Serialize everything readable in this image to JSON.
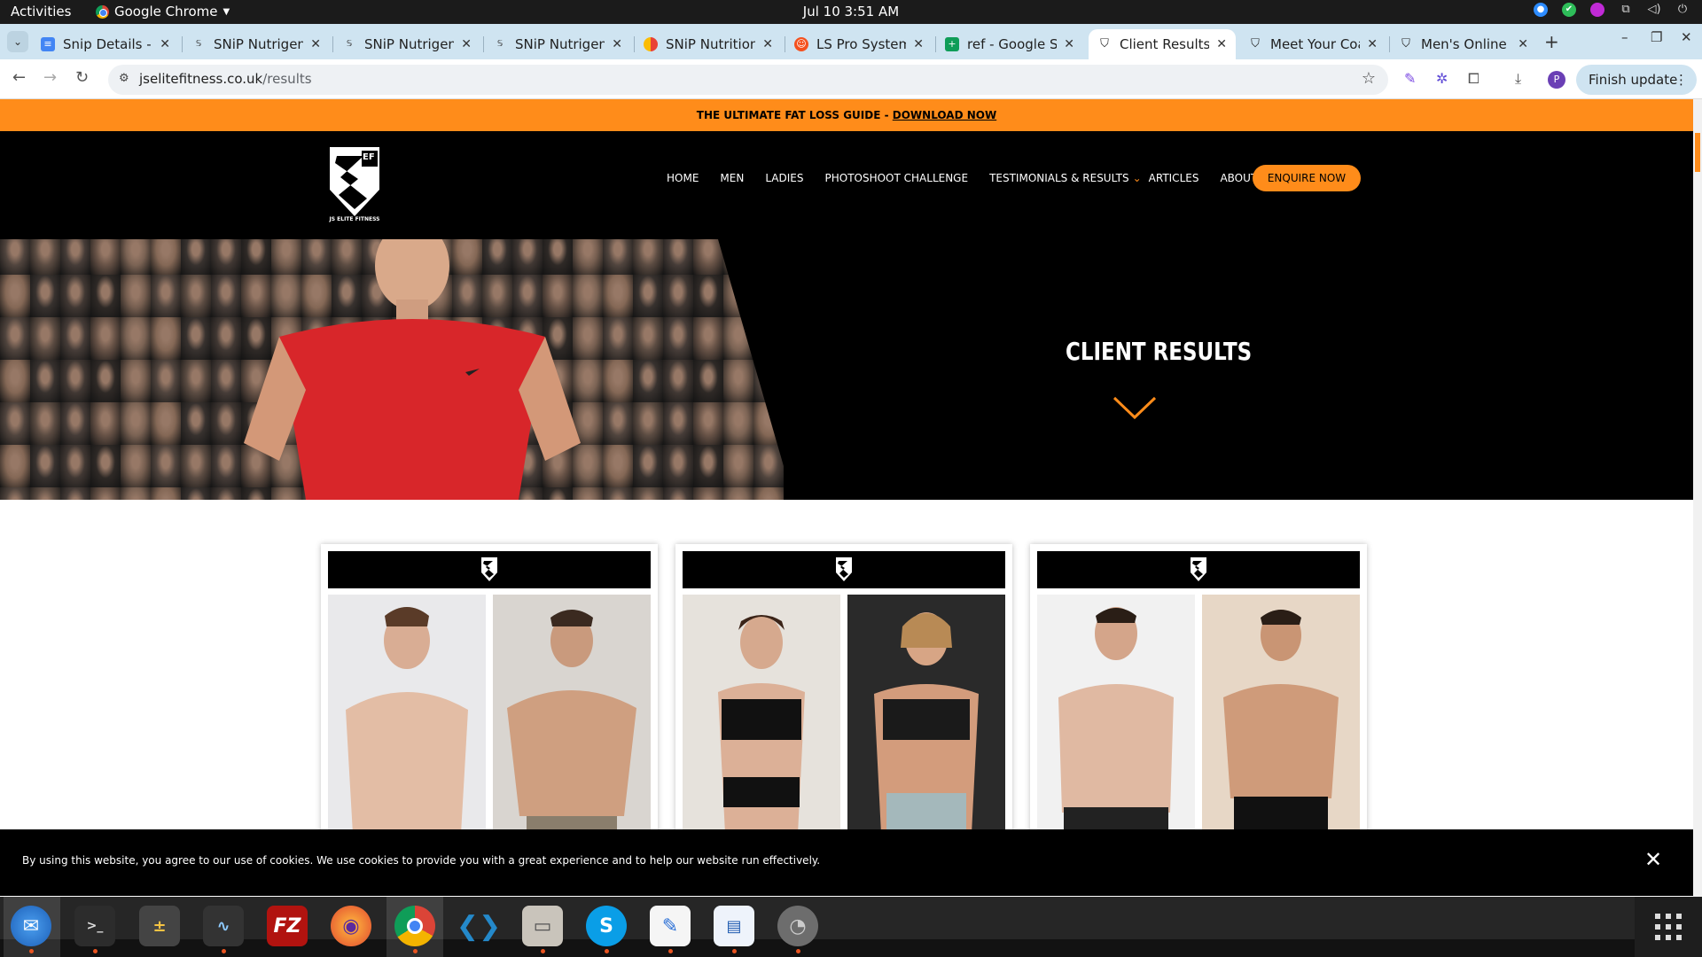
{
  "system_bar": {
    "activities": "Activities",
    "app_name": "Google Chrome",
    "clock": "Jul 10  3:51 AM",
    "tray_icons": [
      "zoom-icon",
      "checkmark-shield-icon",
      "color-ball-icon",
      "network-icon",
      "volume-icon",
      "power-icon"
    ]
  },
  "browser": {
    "tabs": [
      {
        "title": "Snip Details - C",
        "icon": "docs-icon",
        "active": false
      },
      {
        "title": "SNiP Nutrigen",
        "icon": "snip-icon",
        "active": false
      },
      {
        "title": "SNiP Nutrigen",
        "icon": "snip-icon",
        "active": false
      },
      {
        "title": "SNiP Nutrigen",
        "icon": "snip-icon",
        "active": false
      },
      {
        "title": "SNiP Nutrition",
        "icon": "snip-ball-icon",
        "active": false
      },
      {
        "title": "LS Pro System",
        "icon": "ls-icon",
        "active": false
      },
      {
        "title": "ref - Google Sh",
        "icon": "sheets-icon",
        "active": false
      },
      {
        "title": "Client Results",
        "icon": "jsef-shield-icon",
        "active": true
      },
      {
        "title": "Meet Your Coa",
        "icon": "jsef-shield-icon",
        "active": false
      },
      {
        "title": "Men's Online C",
        "icon": "jsef-shield-icon",
        "active": false
      }
    ],
    "url_host": "jselitefitness.co.uk",
    "url_path": "/results",
    "finish_update": "Finish update",
    "profile_initial": "P"
  },
  "site": {
    "promo_text": "THE ULTIMATE FAT LOSS GUIDE - ",
    "promo_link": "DOWNLOAD NOW",
    "logo_text": "JS ELITE FITNESS",
    "logo_letters": "EF",
    "menu": [
      "HOME",
      "MEN",
      "LADIES",
      "PHOTOSHOOT CHALLENGE",
      "TESTIMONIALS & RESULTS",
      "ARTICLES",
      "ABOUT"
    ],
    "enquire": "ENQUIRE NOW",
    "hero_title": "CLIENT RESULTS",
    "accent": "#ff8c1a",
    "cookie_text": "By using this website, you agree to our use of cookies. We use cookies to provide you with a great experience and to help our website run effectively."
  },
  "dock": [
    "thunderbird-icon",
    "terminal-icon",
    "calculator-icon",
    "system-monitor-icon",
    "filezilla-icon",
    "firefox-icon",
    "chrome-icon",
    "vscode-icon",
    "files-icon",
    "skype-icon",
    "text-editor-icon",
    "libreoffice-writer-icon",
    "disk-utility-icon"
  ]
}
